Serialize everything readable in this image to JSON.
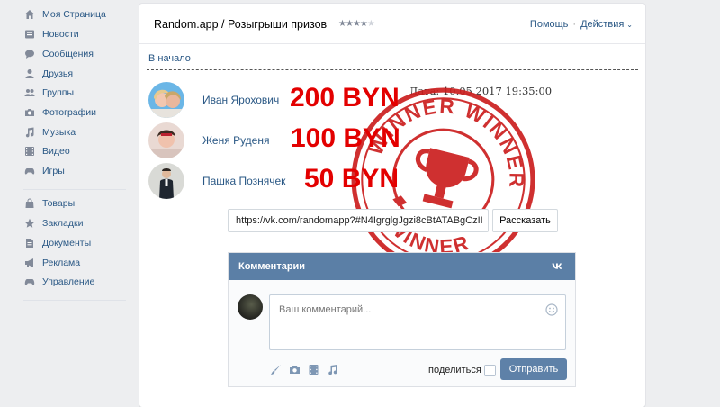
{
  "sidebar": {
    "items": [
      {
        "label": "Моя Страница",
        "icon": "home-icon"
      },
      {
        "label": "Новости",
        "icon": "news-icon"
      },
      {
        "label": "Сообщения",
        "icon": "messages-icon"
      },
      {
        "label": "Друзья",
        "icon": "friends-icon"
      },
      {
        "label": "Группы",
        "icon": "groups-icon"
      },
      {
        "label": "Фотографии",
        "icon": "camera-icon"
      },
      {
        "label": "Музыка",
        "icon": "music-icon"
      },
      {
        "label": "Видео",
        "icon": "video-icon"
      },
      {
        "label": "Игры",
        "icon": "gamepad-icon"
      },
      {
        "label": "Товары",
        "icon": "shopping-bag-icon"
      },
      {
        "label": "Закладки",
        "icon": "star-icon"
      },
      {
        "label": "Документы",
        "icon": "document-icon"
      },
      {
        "label": "Реклама",
        "icon": "megaphone-icon"
      },
      {
        "label": "Управление",
        "icon": "gamepad-icon"
      }
    ]
  },
  "header": {
    "title": "Random.app / Розыгрыши призов",
    "rating": {
      "filled": 4,
      "total": 5
    },
    "help_label": "Помощь",
    "actions_label": "Действия"
  },
  "back_link": "В начало",
  "date_text": "Дата: 10.05.2017 19:35:00",
  "winners": [
    {
      "name": "Иван Ярохович",
      "prize": "200 BYN"
    },
    {
      "name": "Женя Руденя",
      "prize": "100 BYN"
    },
    {
      "name": "Пашка Познячек",
      "prize": "50 BYN"
    }
  ],
  "stamp": {
    "text": "WINNER",
    "color": "#cc1f1f"
  },
  "share": {
    "url": "https://vk.com/randomapp?#N4IgrglgJgzi8cBtATABgCzII",
    "button_label": "Рассказать"
  },
  "comments": {
    "title": "Комментарии",
    "placeholder": "Ваш комментарий...",
    "share_label": "поделиться",
    "send_label": "Отправить"
  },
  "colors": {
    "link": "#2a5885",
    "prize_red": "#e30000",
    "header_blue": "#5b7fa6",
    "button_blue": "#5e81a8",
    "page_bg": "#edeef0"
  }
}
